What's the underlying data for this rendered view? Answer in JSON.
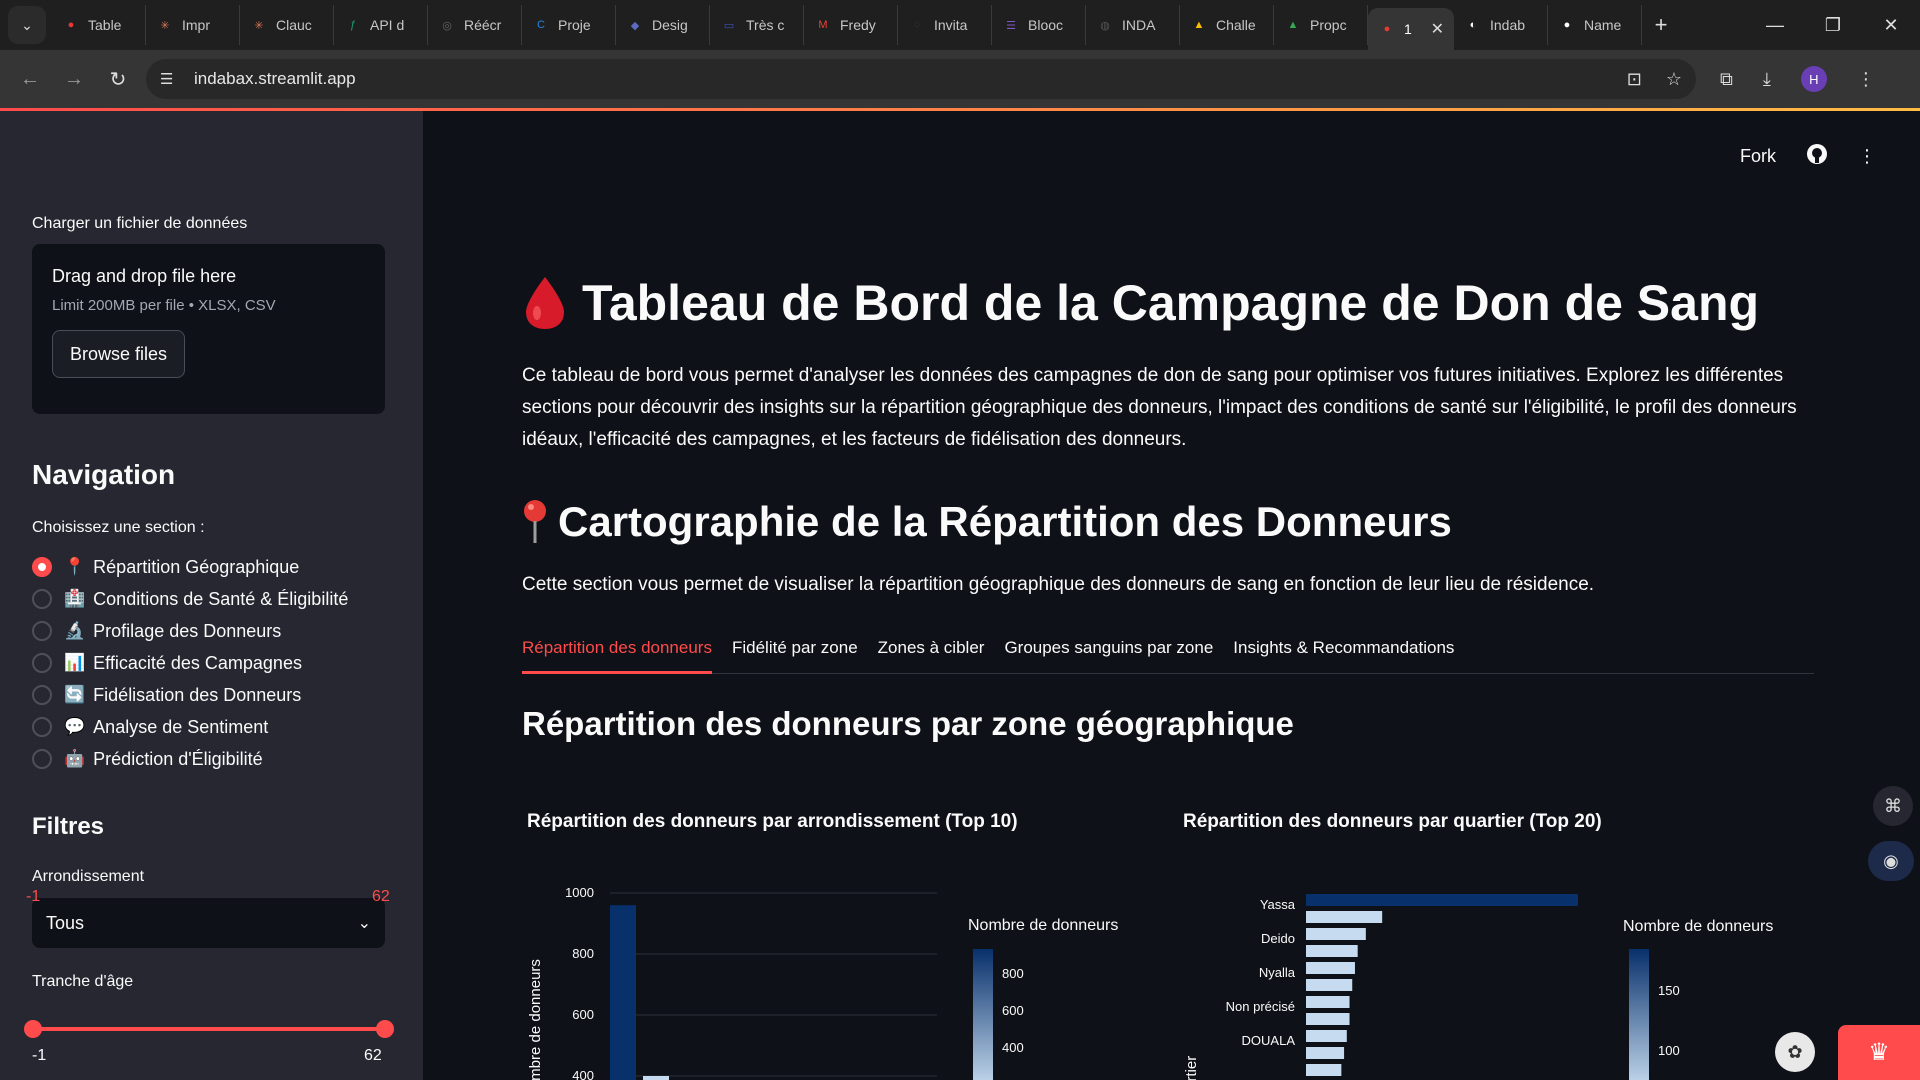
{
  "browser": {
    "tabs": [
      {
        "label": "Table",
        "icon": "blood-drop-icon",
        "color": "#e53935",
        "glyph": "●"
      },
      {
        "label": "Impr",
        "icon": "claude-icon",
        "color": "#d97757",
        "glyph": "✳"
      },
      {
        "label": "Clauc",
        "icon": "claude-icon",
        "color": "#d97757",
        "glyph": "✳"
      },
      {
        "label": "API d",
        "icon": "api-icon",
        "color": "#1b9e77",
        "glyph": "ƒ"
      },
      {
        "label": "Réécr",
        "icon": "chatgpt-icon",
        "color": "#666666",
        "glyph": "◎"
      },
      {
        "label": "Proje",
        "icon": "app-icon",
        "color": "#1e88e5",
        "glyph": "C"
      },
      {
        "label": "Desig",
        "icon": "app-icon",
        "color": "#5c6bc0",
        "glyph": "◆"
      },
      {
        "label": "Très c",
        "icon": "app-icon",
        "color": "#3f51b5",
        "glyph": "▭"
      },
      {
        "label": "Fredy",
        "icon": "gmail-icon",
        "color": "#ea4335",
        "glyph": "M"
      },
      {
        "label": "Invita",
        "icon": "app-icon",
        "color": "#333333",
        "glyph": "○"
      },
      {
        "label": "Blooc",
        "icon": "app-icon",
        "color": "#7e57c2",
        "glyph": "☰"
      },
      {
        "label": "INDA",
        "icon": "globe-icon",
        "color": "#555555",
        "glyph": "◍"
      },
      {
        "label": "Challe",
        "icon": "drive-icon",
        "color": "#fbbc04",
        "glyph": "▲"
      },
      {
        "label": "Propc",
        "icon": "drive-icon",
        "color": "#34a853",
        "glyph": "▲"
      }
    ],
    "active_tab": {
      "label": "1",
      "icon": "blood-drop-icon"
    },
    "tabs_after": [
      {
        "label": "Indab",
        "icon": "app-icon",
        "color": "#ffffff",
        "glyph": "◐"
      },
      {
        "label": "Name",
        "icon": "github-icon",
        "color": "#ffffff",
        "glyph": "●"
      }
    ],
    "url": "indabax.streamlit.app",
    "profile_initial": "H"
  },
  "sidebar": {
    "upload_label": "Charger un fichier de données",
    "upload_drop": "Drag and drop file here",
    "upload_limit": "Limit 200MB per file • XLSX, CSV",
    "browse_label": "Browse files",
    "nav_heading": "Navigation",
    "nav_prompt": "Choisissez une section :",
    "nav_items": [
      {
        "label": "Répartition Géographique",
        "emoji": "📍",
        "selected": true
      },
      {
        "label": "Conditions de Santé & Éligibilité",
        "emoji": "🏥",
        "selected": false
      },
      {
        "label": "Profilage des Donneurs",
        "emoji": "🔬",
        "selected": false
      },
      {
        "label": "Efficacité des Campagnes",
        "emoji": "📊",
        "selected": false
      },
      {
        "label": "Fidélisation des Donneurs",
        "emoji": "🔄",
        "selected": false
      },
      {
        "label": "Analyse de Sentiment",
        "emoji": "💬",
        "selected": false
      },
      {
        "label": "Prédiction d'Éligibilité",
        "emoji": "🤖",
        "selected": false
      }
    ],
    "filters_heading": "Filtres",
    "arrondissement_label": "Arrondissement",
    "arrondissement_value": "Tous",
    "age_label": "Tranche d'âge",
    "age_min": "-1",
    "age_max": "62",
    "age_min_bound": "-1",
    "age_max_bound": "62"
  },
  "header": {
    "fork_label": "Fork"
  },
  "main": {
    "title": "Tableau de Bord de la Campagne de Don de Sang",
    "intro": "Ce tableau de bord vous permet d'analyser les données des campagnes de don de sang pour optimiser vos futures initiatives. Explorez les différentes sections pour découvrir des insights sur la répartition géographique des donneurs, l'impact des conditions de santé sur l'éligibilité, le profil des donneurs idéaux, l'efficacité des campagnes, et les facteurs de fidélisation des donneurs.",
    "section_title": "Cartographie de la Répartition des Donneurs",
    "section_desc": "Cette section vous permet de visualiser la répartition géographique des donneurs de sang en fonction de leur lieu de résidence.",
    "tabs": [
      "Répartition des donneurs",
      "Fidélité par zone",
      "Zones à cibler",
      "Groupes sanguins par zone",
      "Insights & Recommandations"
    ],
    "subheading": "Répartition des donneurs par zone géographique"
  },
  "chart_data": [
    {
      "type": "bar",
      "title": "Répartition des donneurs par arrondissement (Top 10)",
      "ylabel": "Nombre de donneurs",
      "yticks": [
        400,
        600,
        800,
        1000
      ],
      "values_visible": [
        960,
        400
      ],
      "colorbar_title": "Nombre de donneurs",
      "colorbar_ticks": [
        400,
        600,
        800
      ],
      "colorscale": [
        "#c6dbef",
        "#08306b"
      ]
    },
    {
      "type": "bar",
      "orientation": "horizontal",
      "title": "Répartition des donneurs par quartier (Top 20)",
      "ylabel": "Quartier",
      "categories": [
        "Yassa",
        "Deido",
        "Nyalla",
        "Non précisé",
        "DOUALA"
      ],
      "tick_labels": [
        "Yassa",
        "Deido",
        "Nyalla",
        "Non précisé",
        "DOUALA"
      ],
      "bar_relative_lengths": [
        1.0,
        0.28,
        0.22,
        0.19,
        0.18,
        0.17,
        0.16,
        0.16,
        0.15,
        0.14,
        0.13
      ],
      "colorbar_title": "Nombre de donneurs",
      "colorbar_ticks": [
        100,
        150
      ],
      "colorscale": [
        "#c6dbef",
        "#08306b"
      ]
    }
  ]
}
